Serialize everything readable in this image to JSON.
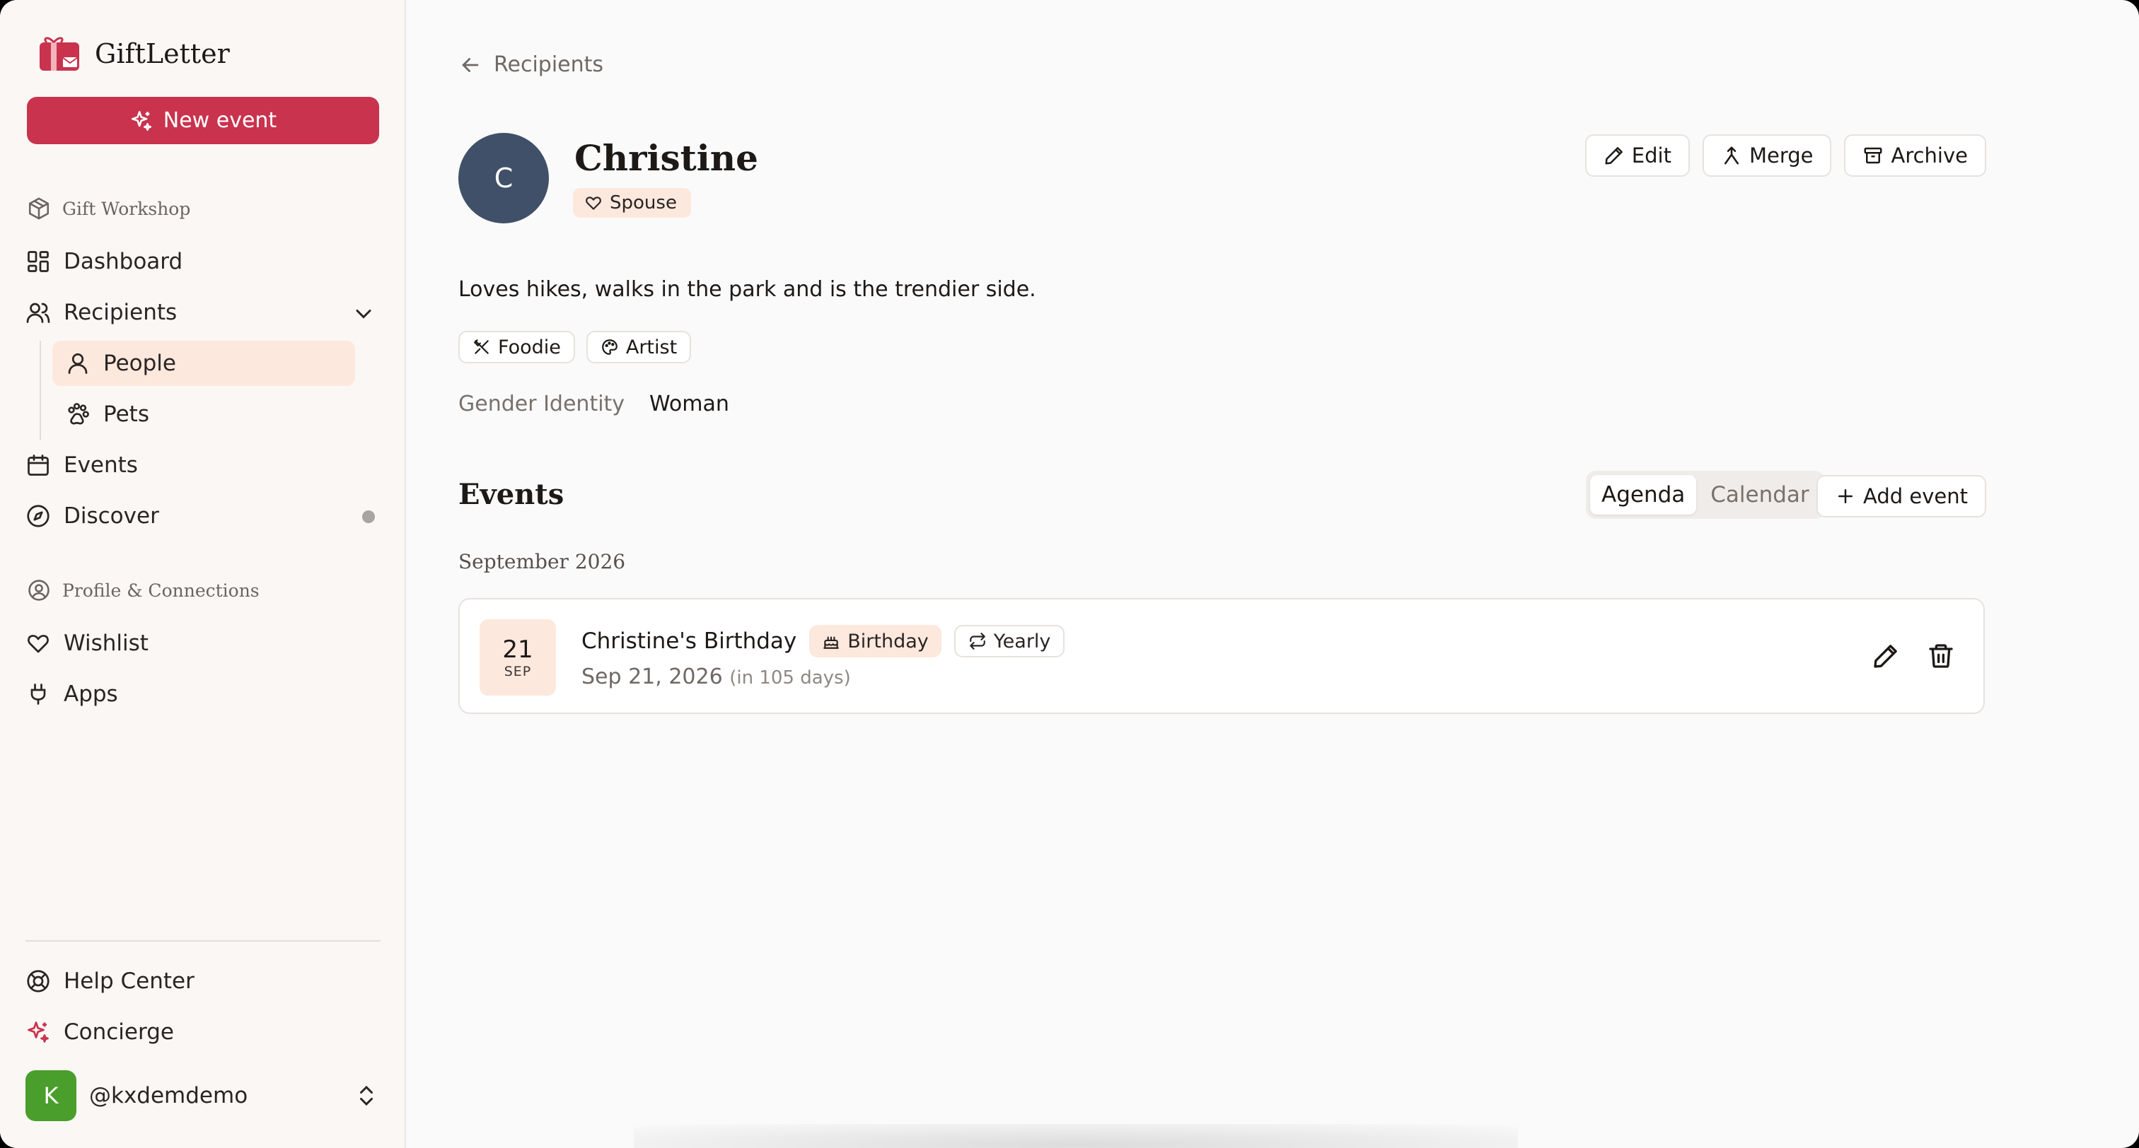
{
  "app": {
    "name": "GiftLetter"
  },
  "sidebar": {
    "new_event_label": "New event",
    "workshop_label": "Gift Workshop",
    "nav": {
      "dashboard": "Dashboard",
      "recipients": "Recipients",
      "people": "People",
      "pets": "Pets",
      "events": "Events",
      "discover": "Discover"
    },
    "profile_label": "Profile & Connections",
    "profile_nav": {
      "wishlist": "Wishlist",
      "apps": "Apps"
    },
    "bottom": {
      "help": "Help Center",
      "concierge": "Concierge"
    },
    "user": {
      "initial": "K",
      "handle": "@kxdemdemo"
    }
  },
  "breadcrumb": {
    "back_label": "Recipients"
  },
  "recipient": {
    "initial": "C",
    "name": "Christine",
    "relationship": "Spouse",
    "bio": "Loves hikes, walks in the park and is the trendier side.",
    "tags": [
      "Foodie",
      "Artist"
    ],
    "attribute_label": "Gender Identity",
    "attribute_value": "Woman"
  },
  "actions": {
    "edit": "Edit",
    "merge": "Merge",
    "archive": "Archive"
  },
  "events_section": {
    "title": "Events",
    "view_tabs": [
      "Agenda",
      "Calendar"
    ],
    "active_view": "Agenda",
    "add_event_label": "Add event",
    "month_heading": "September 2026",
    "items": [
      {
        "day": "21",
        "month_abbr": "SEP",
        "title": "Christine's Birthday",
        "type": "Birthday",
        "recurrence": "Yearly",
        "date": "Sep 21, 2026",
        "relative": "(in 105 days)"
      }
    ]
  },
  "colors": {
    "brand": "#c9334d",
    "highlight": "#fde8de",
    "avatar": "#3f5068",
    "user_avatar": "#4a9e2b"
  }
}
